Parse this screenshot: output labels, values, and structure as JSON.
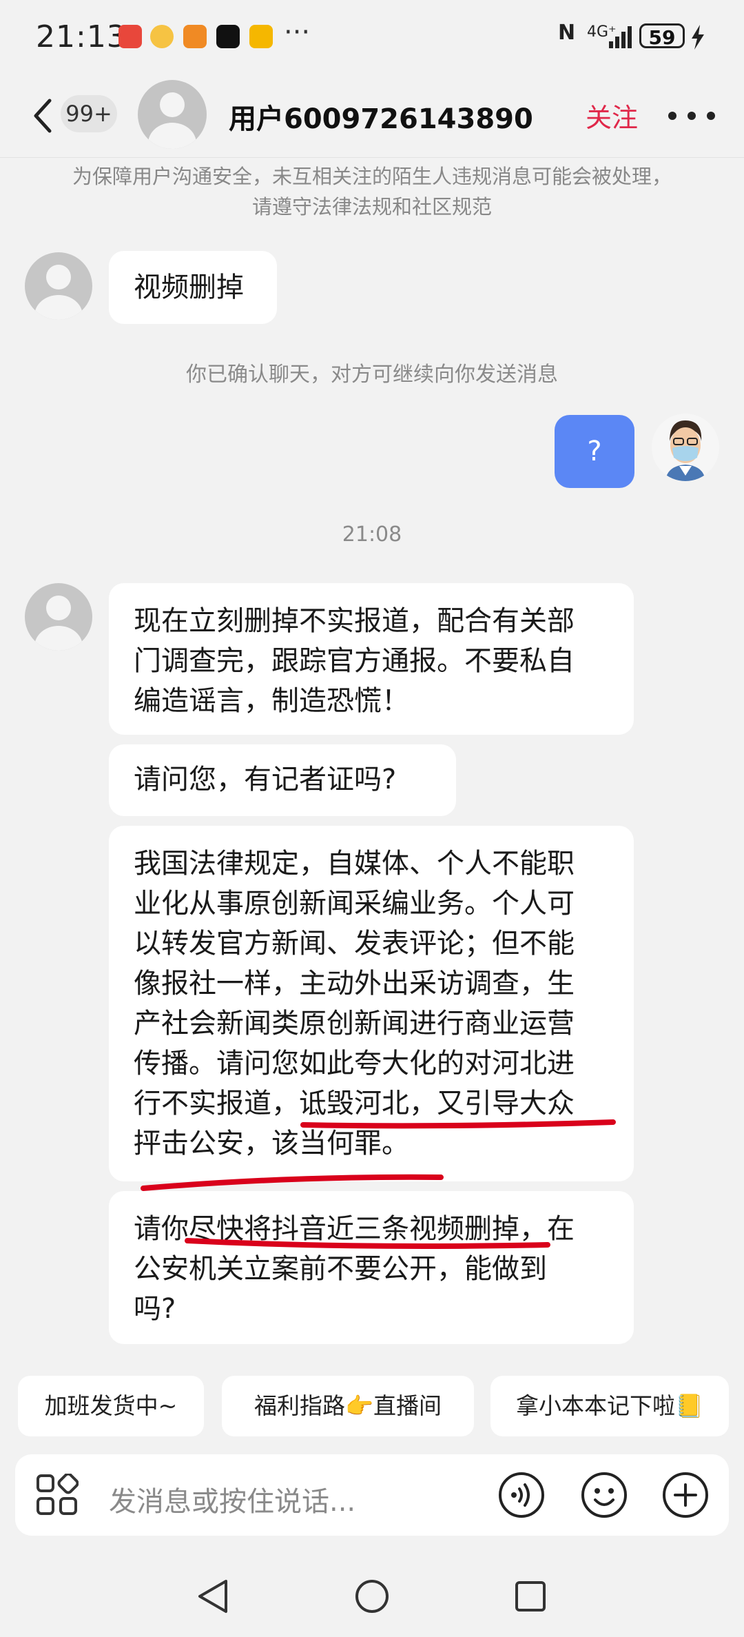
{
  "status_bar": {
    "time": "21:13",
    "dots": "···",
    "network": "4G⁺",
    "battery": "59"
  },
  "header": {
    "badge": "99+",
    "username": "用户6009726143890",
    "follow_label": "关注"
  },
  "notice": "为保障用户沟通安全，未互相关注的陌生人违规消息可能会被处理，请遵守法律法规和社区规范",
  "messages": {
    "m1": "视频删掉",
    "system1": "你已确认聊天，对方可继续向你发送消息",
    "mine": "?",
    "timestamp": "21:08",
    "m2": "现在立刻删掉不实报道，配合有关部\n门调查完，跟踪官方通报。不要私自\n编造谣言，制造恐慌！",
    "m3": "请问您，有记者证吗?",
    "m4": "我国法律规定，自媒体、个人不能职\n业化从事原创新闻采编业务。个人可\n以转发官方新闻、发表评论；但不能\n像报社一样，主动外出采访调查，生\n产社会新闻类原创新闻进行商业运营\n传播。请问您如此夸大化的对河北进\n行不实报道，诋毁河北，又引导大众\n抨击公安，该当何罪。",
    "m5": "请你尽快将抖音近三条视频删掉，在\n公安机关立案前不要公开，能做到\n吗?"
  },
  "quick_replies": [
    "加班发货中~",
    "福利指路👉直播间",
    "拿小本本记下啦📒"
  ],
  "input": {
    "placeholder": "发消息或按住说话..."
  },
  "colors": {
    "follow": "#e0284a",
    "my_bubble": "#5b87f5",
    "annotation": "#d9001b"
  }
}
